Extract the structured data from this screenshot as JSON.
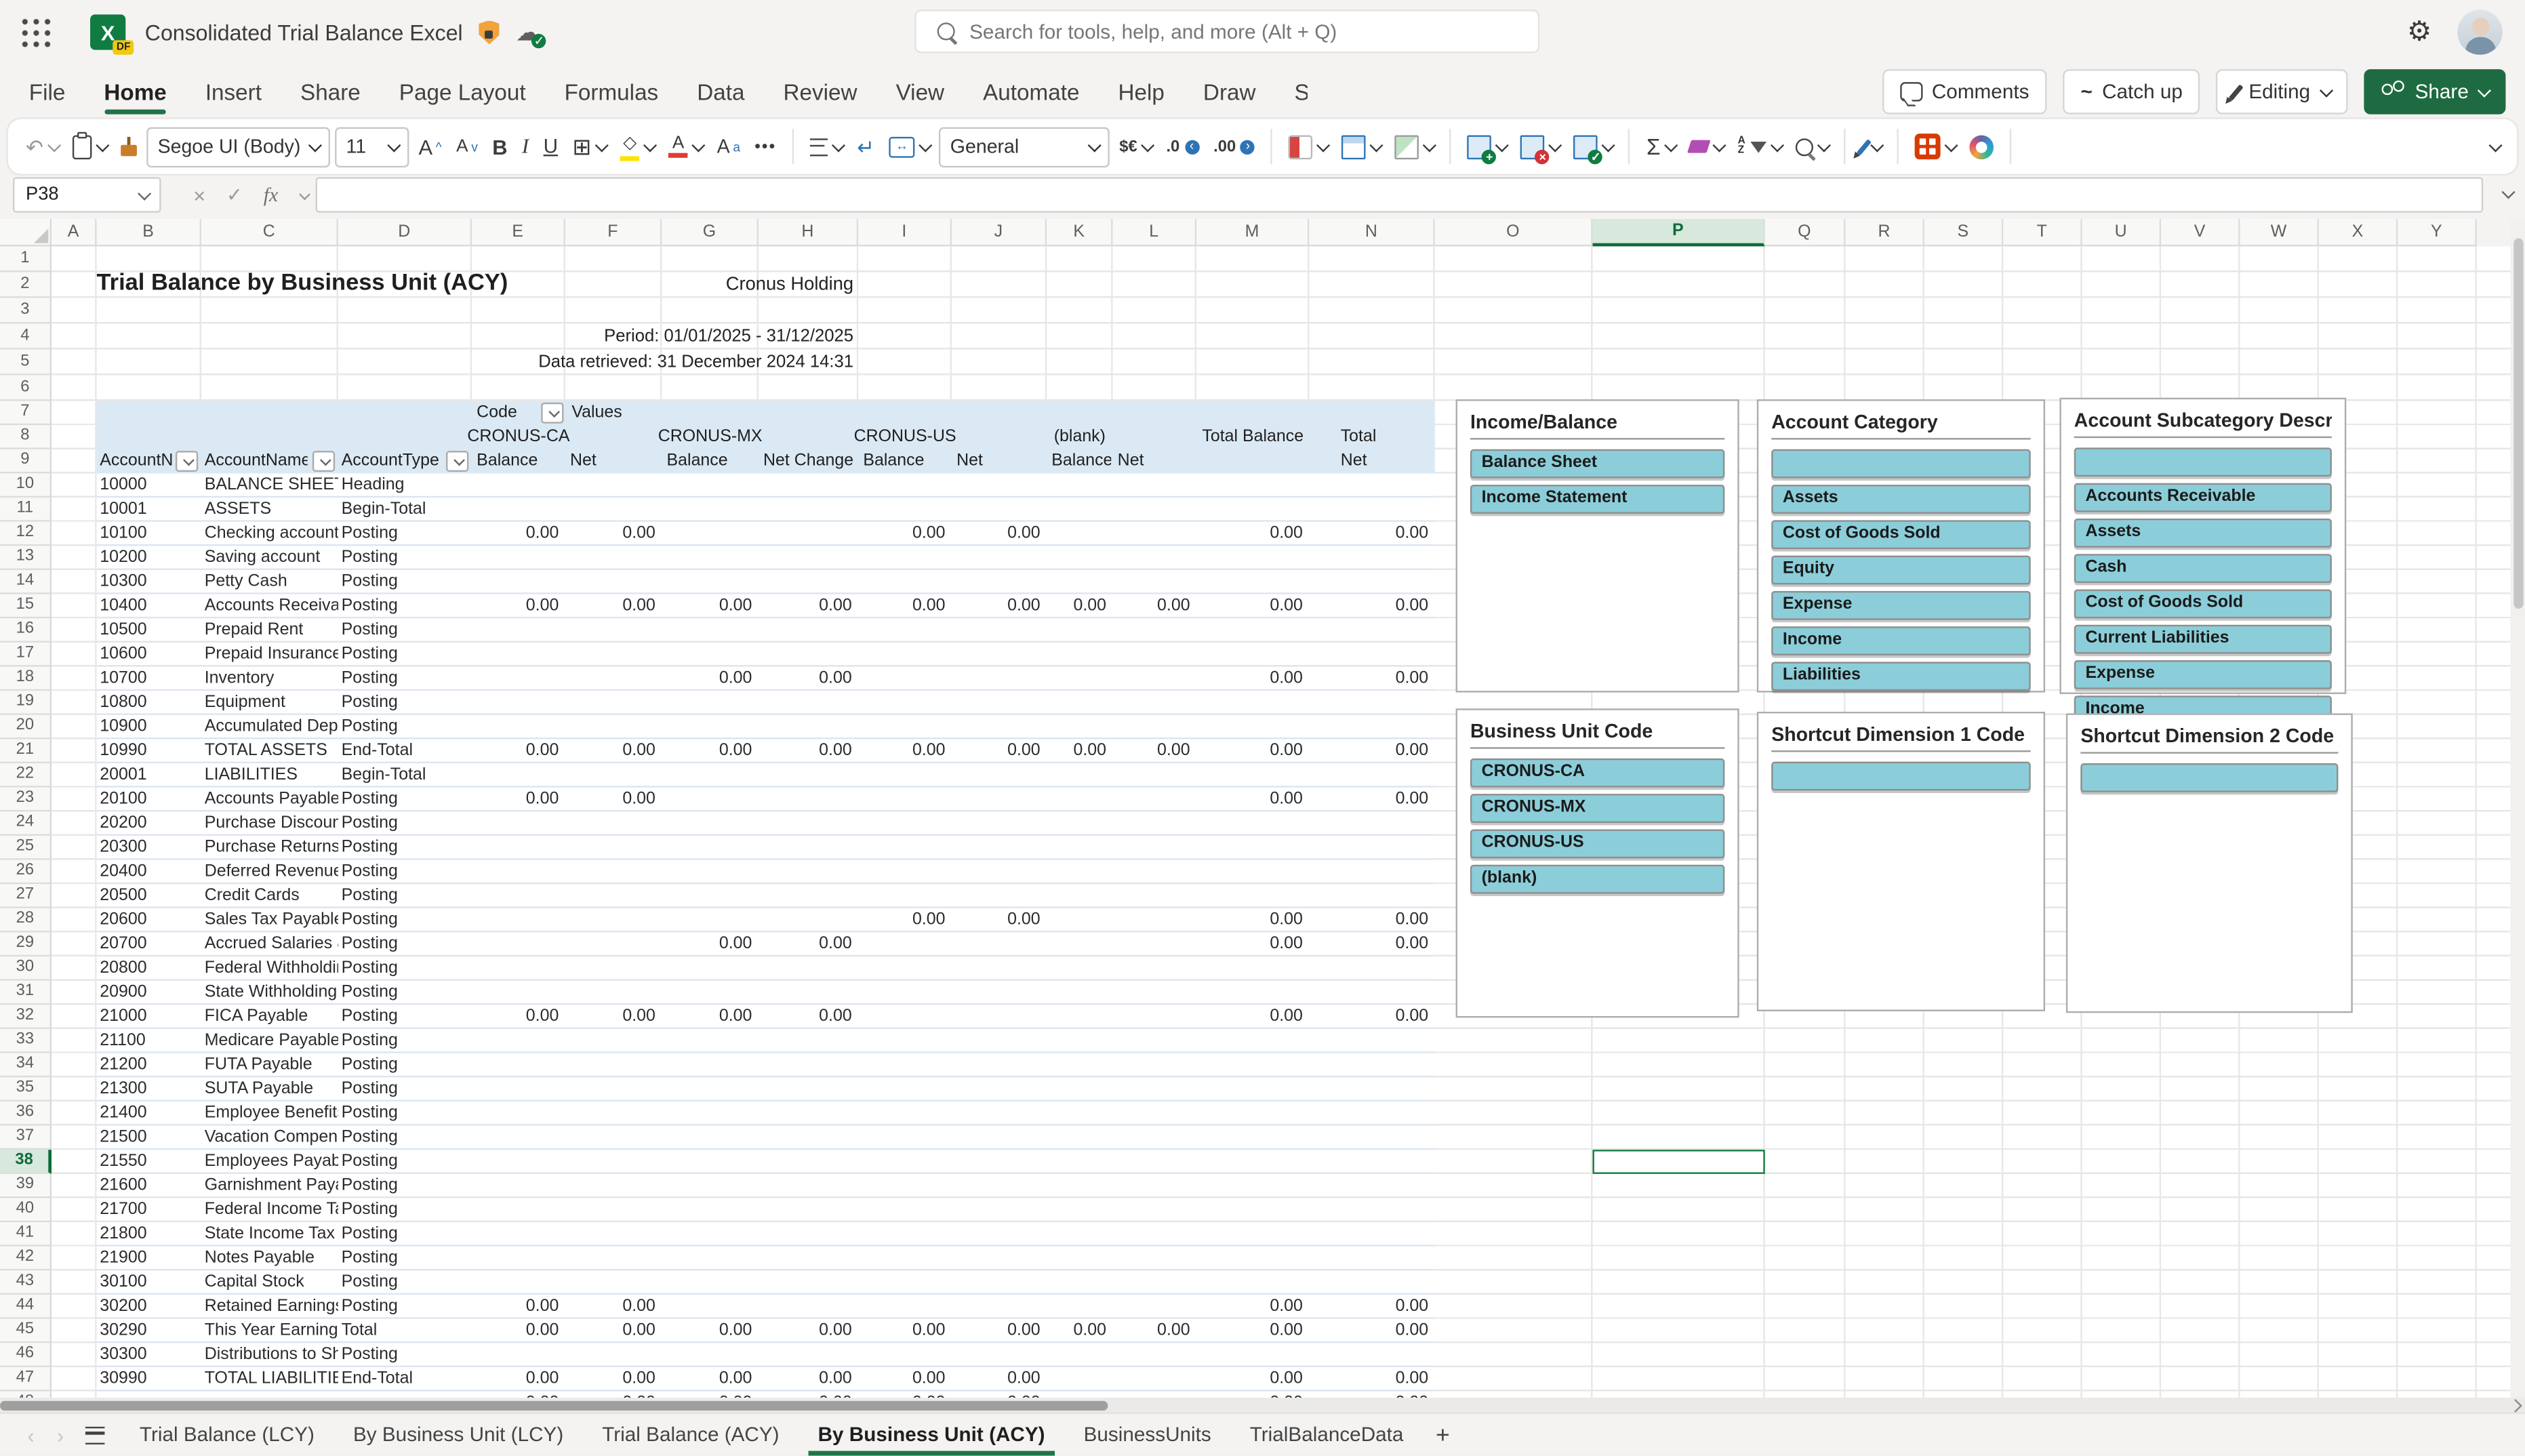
{
  "icons": {
    "waffle": "app-launcher-grid",
    "excel_logo": "green square with X and DF badge",
    "protected": "orange shield with lock",
    "saved": "cloud with green check",
    "search": "magnifier",
    "settings": "gear",
    "comments": "speech-bubble",
    "catch_up": "~",
    "editing": "pencil",
    "share": "two people",
    "dropdown": "chevron-down"
  },
  "topbar": {
    "title": "Consolidated Trial Balance Excel",
    "search_placeholder": "Search for tools, help, and more (Alt + Q)"
  },
  "menubar": {
    "items": [
      "File",
      "Home",
      "Insert",
      "Share",
      "Page Layout",
      "Formulas",
      "Data",
      "Review",
      "View",
      "Automate",
      "Help",
      "Draw",
      "S"
    ],
    "active_item": "Home"
  },
  "actions": {
    "comments": "Comments",
    "catch_up": "Catch up",
    "editing": "Editing",
    "share": "Share"
  },
  "ribbon": {
    "font_name": "Segoe UI (Body)",
    "font_size": "11",
    "number_format": "General",
    "currency": "$€",
    "decrease_decimal": ".0",
    "increase_decimal": ".00"
  },
  "formula_bar": {
    "name_box": "P38",
    "formula": ""
  },
  "grid": {
    "column_letters": [
      "A",
      "B",
      "C",
      "D",
      "E",
      "F",
      "G",
      "H",
      "I",
      "J",
      "K",
      "L",
      "M",
      "N",
      "O",
      "P",
      "Q",
      "R",
      "S",
      "T",
      "U",
      "V",
      "W",
      "X",
      "Y"
    ],
    "visible_rows": 48,
    "selected_column": "P",
    "selected_row": 38
  },
  "sheet": {
    "title": "Trial Balance by Business Unit (ACY)",
    "company": "Cronus Holding",
    "period_line": "Period: 01/01/2025 - 31/12/2025",
    "retrieved_line": "Data retrieved: 31 December 2024 14:31"
  },
  "pivot": {
    "corner_label": "Code",
    "values_label": "Values",
    "group_headers": [
      "CRONUS-CA",
      "CRONUS-MX",
      "CRONUS-US",
      "(blank)",
      "Total Balance",
      "Total Net Change"
    ],
    "row_field_headers": [
      "AccountNumber",
      "AccountName",
      "AccountType"
    ],
    "measure_headers": [
      "Balance",
      "Net Change",
      "Balance",
      "Net Change",
      "Balance",
      "Net Change",
      "Balance",
      "Net Change"
    ],
    "rows": [
      [
        "10000",
        "BALANCE SHEET",
        "Heading",
        "",
        "",
        "",
        "",
        "",
        "",
        "",
        "",
        "",
        ""
      ],
      [
        "10001",
        "ASSETS",
        "Begin-Total",
        "",
        "",
        "",
        "",
        "",
        "",
        "",
        "",
        "",
        ""
      ],
      [
        "10100",
        "Checking account",
        "Posting",
        "0.00",
        "0.00",
        "",
        "",
        "0.00",
        "0.00",
        "",
        "",
        "0.00",
        "0.00"
      ],
      [
        "10200",
        "Saving account",
        "Posting",
        "",
        "",
        "",
        "",
        "",
        "",
        "",
        "",
        "",
        ""
      ],
      [
        "10300",
        "Petty Cash",
        "Posting",
        "",
        "",
        "",
        "",
        "",
        "",
        "",
        "",
        "",
        ""
      ],
      [
        "10400",
        "Accounts Receivabl",
        "Posting",
        "0.00",
        "0.00",
        "0.00",
        "0.00",
        "0.00",
        "0.00",
        "0.00",
        "0.00",
        "0.00",
        "0.00"
      ],
      [
        "10500",
        "Prepaid Rent",
        "Posting",
        "",
        "",
        "",
        "",
        "",
        "",
        "",
        "",
        "",
        ""
      ],
      [
        "10600",
        "Prepaid Insurance",
        "Posting",
        "",
        "",
        "",
        "",
        "",
        "",
        "",
        "",
        "",
        ""
      ],
      [
        "10700",
        "Inventory",
        "Posting",
        "",
        "",
        "0.00",
        "0.00",
        "",
        "",
        "",
        "",
        "0.00",
        "0.00"
      ],
      [
        "10800",
        "Equipment",
        "Posting",
        "",
        "",
        "",
        "",
        "",
        "",
        "",
        "",
        "",
        ""
      ],
      [
        "10900",
        "Accumulated Depre",
        "Posting",
        "",
        "",
        "",
        "",
        "",
        "",
        "",
        "",
        "",
        ""
      ],
      [
        "10990",
        "TOTAL ASSETS",
        "End-Total",
        "0.00",
        "0.00",
        "0.00",
        "0.00",
        "0.00",
        "0.00",
        "0.00",
        "0.00",
        "0.00",
        "0.00"
      ],
      [
        "20001",
        "LIABILITIES",
        "Begin-Total",
        "",
        "",
        "",
        "",
        "",
        "",
        "",
        "",
        "",
        ""
      ],
      [
        "20100",
        "Accounts Payable",
        "Posting",
        "0.00",
        "0.00",
        "",
        "",
        "",
        "",
        "",
        "",
        "0.00",
        "0.00"
      ],
      [
        "20200",
        "Purchase Discounts",
        "Posting",
        "",
        "",
        "",
        "",
        "",
        "",
        "",
        "",
        "",
        ""
      ],
      [
        "20300",
        "Purchase Returns &",
        "Posting",
        "",
        "",
        "",
        "",
        "",
        "",
        "",
        "",
        "",
        ""
      ],
      [
        "20400",
        "Deferred Revenue",
        "Posting",
        "",
        "",
        "",
        "",
        "",
        "",
        "",
        "",
        "",
        ""
      ],
      [
        "20500",
        "Credit Cards",
        "Posting",
        "",
        "",
        "",
        "",
        "",
        "",
        "",
        "",
        "",
        ""
      ],
      [
        "20600",
        "Sales Tax Payable",
        "Posting",
        "",
        "",
        "",
        "",
        "0.00",
        "0.00",
        "",
        "",
        "0.00",
        "0.00"
      ],
      [
        "20700",
        "Accrued Salaries &",
        "Posting",
        "",
        "",
        "0.00",
        "0.00",
        "",
        "",
        "",
        "",
        "0.00",
        "0.00"
      ],
      [
        "20800",
        "Federal Withholding",
        "Posting",
        "",
        "",
        "",
        "",
        "",
        "",
        "",
        "",
        "",
        ""
      ],
      [
        "20900",
        "State Withholding F",
        "Posting",
        "",
        "",
        "",
        "",
        "",
        "",
        "",
        "",
        "",
        ""
      ],
      [
        "21000",
        "FICA Payable",
        "Posting",
        "0.00",
        "0.00",
        "0.00",
        "0.00",
        "",
        "",
        "",
        "",
        "0.00",
        "0.00"
      ],
      [
        "21100",
        "Medicare Payable",
        "Posting",
        "",
        "",
        "",
        "",
        "",
        "",
        "",
        "",
        "",
        ""
      ],
      [
        "21200",
        "FUTA Payable",
        "Posting",
        "",
        "",
        "",
        "",
        "",
        "",
        "",
        "",
        "",
        ""
      ],
      [
        "21300",
        "SUTA Payable",
        "Posting",
        "",
        "",
        "",
        "",
        "",
        "",
        "",
        "",
        "",
        ""
      ],
      [
        "21400",
        "Employee Benefits I",
        "Posting",
        "",
        "",
        "",
        "",
        "",
        "",
        "",
        "",
        "",
        ""
      ],
      [
        "21500",
        "Vacation Compensa",
        "Posting",
        "",
        "",
        "",
        "",
        "",
        "",
        "",
        "",
        "",
        ""
      ],
      [
        "21550",
        "Employees Payable",
        "Posting",
        "",
        "",
        "",
        "",
        "",
        "",
        "",
        "",
        "",
        ""
      ],
      [
        "21600",
        "Garnishment Payab",
        "Posting",
        "",
        "",
        "",
        "",
        "",
        "",
        "",
        "",
        "",
        ""
      ],
      [
        "21700",
        "Federal Income Tax",
        "Posting",
        "",
        "",
        "",
        "",
        "",
        "",
        "",
        "",
        "",
        ""
      ],
      [
        "21800",
        "State Income Tax Pa",
        "Posting",
        "",
        "",
        "",
        "",
        "",
        "",
        "",
        "",
        "",
        ""
      ],
      [
        "21900",
        "Notes Payable",
        "Posting",
        "",
        "",
        "",
        "",
        "",
        "",
        "",
        "",
        "",
        ""
      ],
      [
        "30100",
        "Capital Stock",
        "Posting",
        "",
        "",
        "",
        "",
        "",
        "",
        "",
        "",
        "",
        ""
      ],
      [
        "30200",
        "Retained Earnings",
        "Posting",
        "0.00",
        "0.00",
        "",
        "",
        "",
        "",
        "",
        "",
        "0.00",
        "0.00"
      ],
      [
        "30290",
        "This Year Earnings",
        "Total",
        "0.00",
        "0.00",
        "0.00",
        "0.00",
        "0.00",
        "0.00",
        "0.00",
        "0.00",
        "0.00",
        "0.00"
      ],
      [
        "30300",
        "Distributions to Sha",
        "Posting",
        "",
        "",
        "",
        "",
        "",
        "",
        "",
        "",
        "",
        ""
      ],
      [
        "30990",
        "TOTAL LIABILITIES",
        "End-Total",
        "0.00",
        "0.00",
        "0.00",
        "0.00",
        "0.00",
        "0.00",
        "",
        "",
        "0.00",
        "0.00"
      ]
    ],
    "row48_partial": [
      "",
      "",
      "",
      "0.00",
      "0.00",
      "0.00",
      "0.00",
      "0.00",
      "0.00",
      "",
      "",
      "0.00",
      "0.00"
    ]
  },
  "slicers": [
    {
      "title": "Income/Balance",
      "items": [
        "Balance Sheet",
        "Income Statement"
      ]
    },
    {
      "title": "Account Category",
      "items": [
        "",
        "Assets",
        "Cost of Goods Sold",
        "Equity",
        "Expense",
        "Income",
        "Liabilities"
      ]
    },
    {
      "title": "Account Subcategory Descr...",
      "items": [
        "",
        "Accounts Receivable",
        "Assets",
        "Cash",
        "Cost of Goods Sold",
        "Current Liabilities",
        "Expense",
        "Income"
      ]
    },
    {
      "title": "Business Unit Code",
      "items": [
        "CRONUS-CA",
        "CRONUS-MX",
        "CRONUS-US",
        "(blank)"
      ]
    },
    {
      "title": "Shortcut Dimension 1 Code",
      "items": [
        ""
      ]
    },
    {
      "title": "Shortcut Dimension 2 Code",
      "items": [
        ""
      ]
    }
  ],
  "sheet_tabs": {
    "tabs": [
      "Trial Balance (LCY)",
      "By Business Unit (LCY)",
      "Trial Balance (ACY)",
      "By Business Unit (ACY)",
      "BusinessUnits",
      "TrialBalanceData"
    ],
    "active": "By Business Unit (ACY)"
  }
}
